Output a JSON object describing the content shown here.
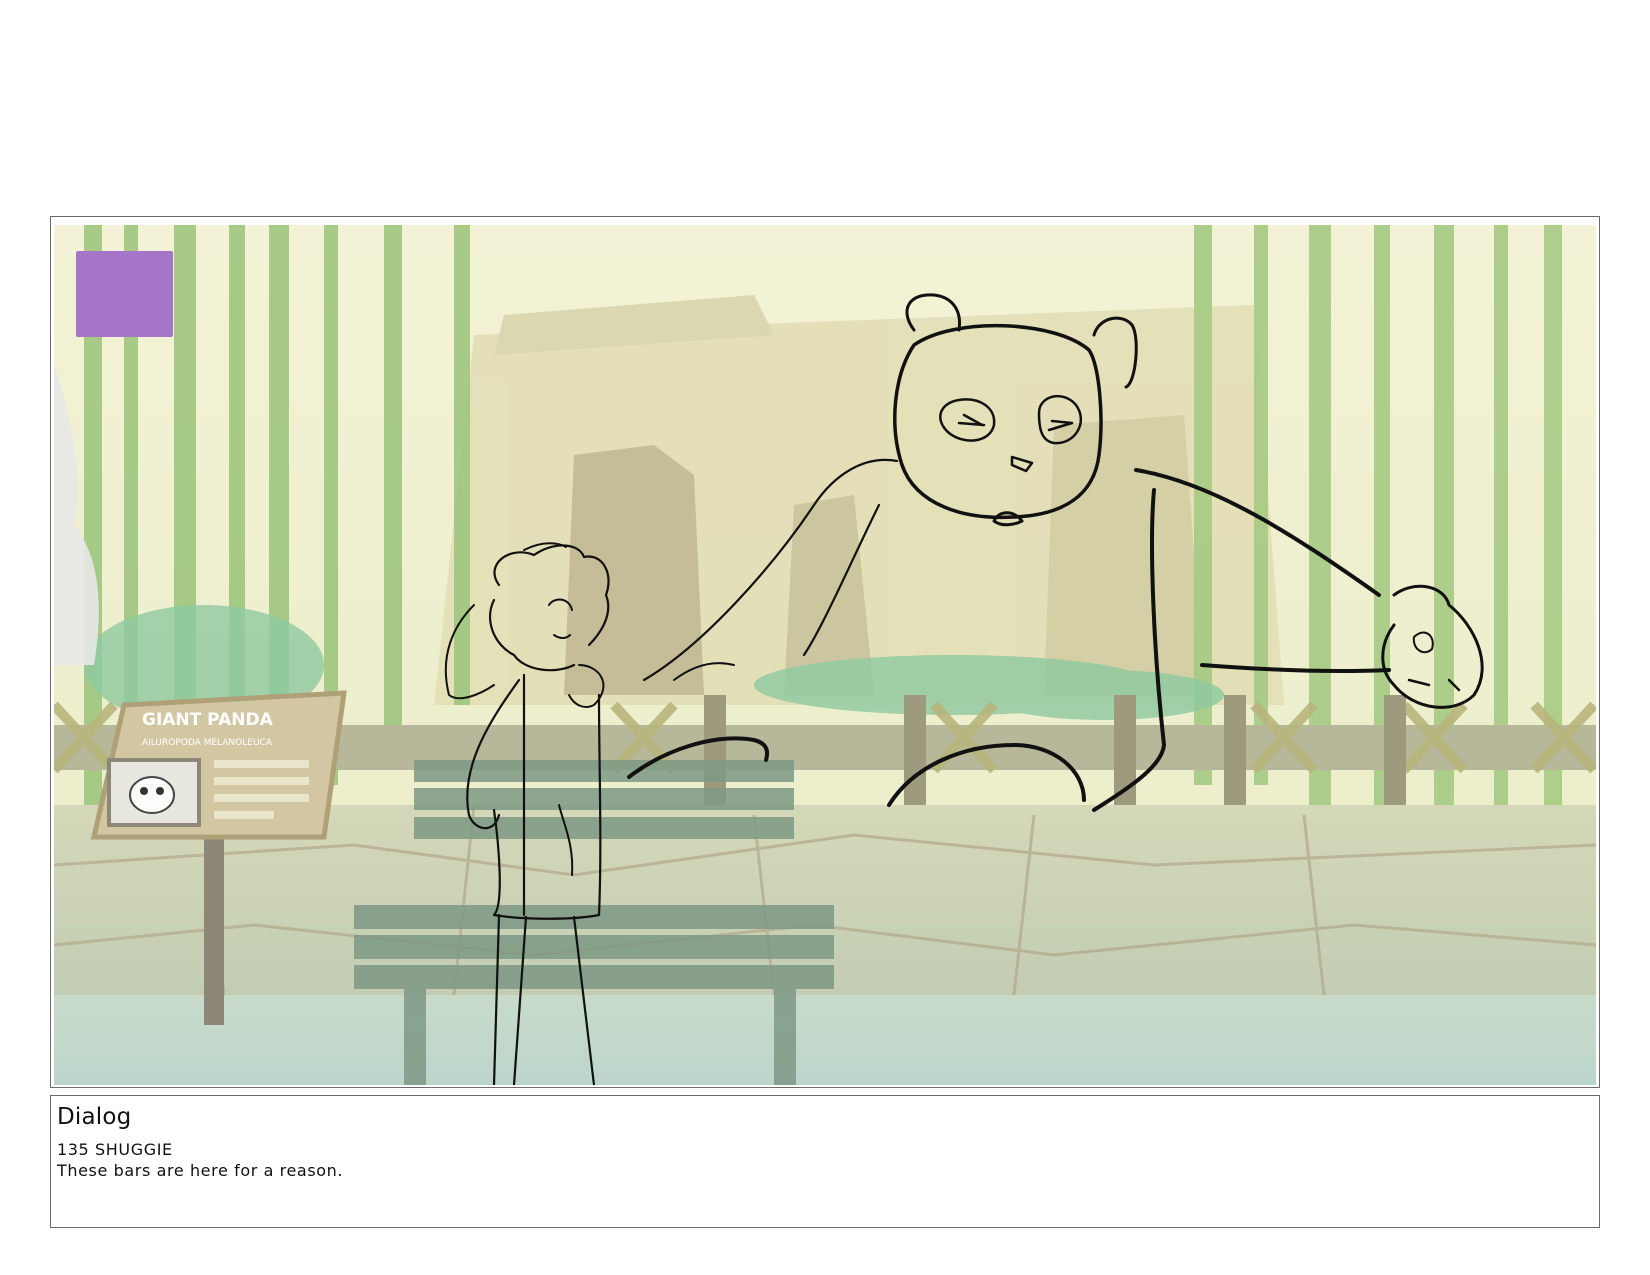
{
  "panel": {
    "sign_title": "GIANT PANDA",
    "sign_subtitle": "AILUROPODA MELANOLEUCA",
    "marker_color": "#a575c8",
    "bg_colors": {
      "sky": "#eef0cf",
      "bamboo": "#9cc77a",
      "wall": "#cbd2b4",
      "ground": "#c9dcc8",
      "ink": "#111111"
    },
    "icons": [
      "purple-square-marker",
      "panda-sketch",
      "girl-sketch",
      "bench",
      "info-sign"
    ]
  },
  "dialog": {
    "heading": "Dialog",
    "speaker": "135 SHUGGIE",
    "line": "These bars are here for a reason."
  }
}
